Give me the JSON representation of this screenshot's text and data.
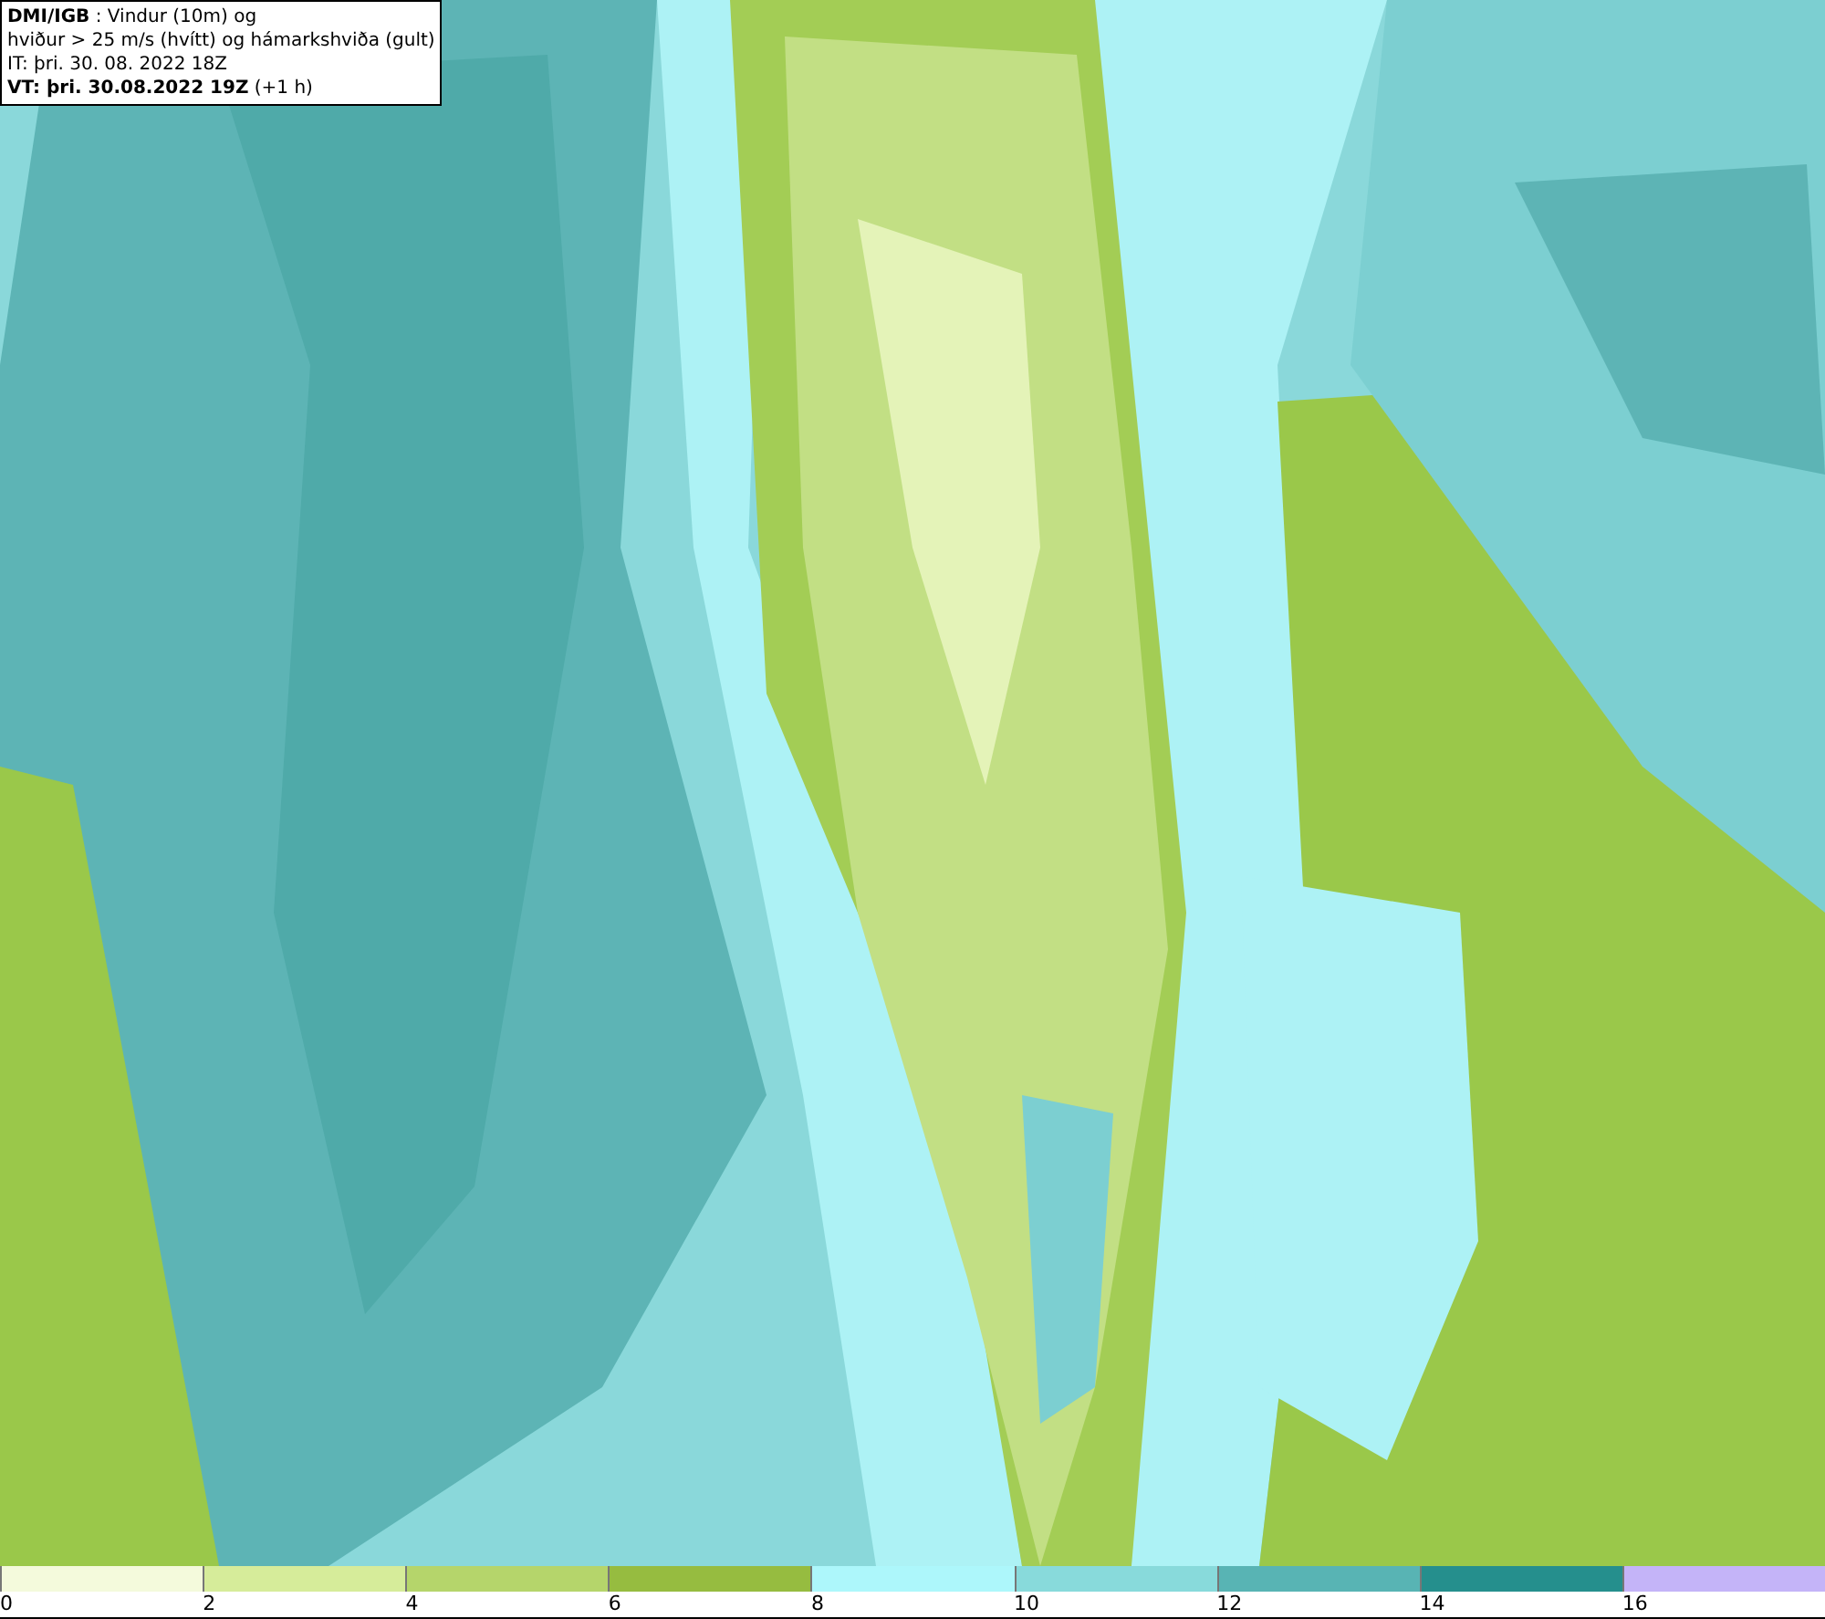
{
  "info_box": {
    "lines": [
      "**DMI/IGB** : Vindur (10m) og",
      "hviður > 25 m/s (hvítt) og hámarkshviða (gult)",
      "IT: þri. 30. 08. 2022 18Z",
      "**VT: þri. 30.08.2022 19Z** (+1 h)"
    ]
  },
  "legend": {
    "bins": [
      {
        "color": "#f4fadc",
        "label": "0"
      },
      {
        "color": "#d6ec9a",
        "label": "2"
      },
      {
        "color": "#b5d56b",
        "label": "4"
      },
      {
        "color": "#96bc40",
        "label": "6"
      },
      {
        "color": "#adf7fb",
        "label": "8"
      },
      {
        "color": "#88dadb",
        "label": "10"
      },
      {
        "color": "#58b4b4",
        "label": "12"
      },
      {
        "color": "#258f8d",
        "label": "14"
      },
      {
        "color": "#c4b4f8",
        "label": "16"
      }
    ]
  }
}
